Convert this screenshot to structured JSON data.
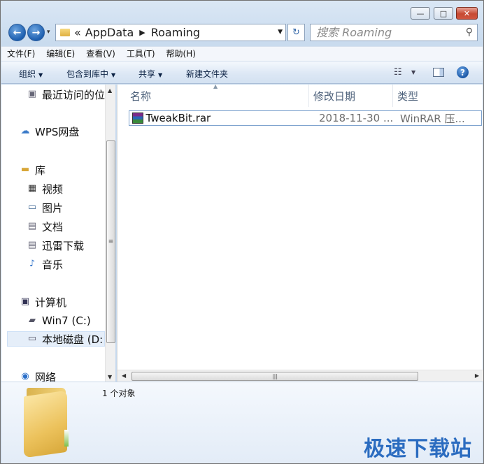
{
  "window": {
    "caption_buttons": {
      "minimize": "—",
      "maximize": "□",
      "close": "✕"
    }
  },
  "navigation": {
    "back_glyph": "←",
    "forward_glyph": "→",
    "history_glyph": "▾",
    "breadcrumb": [
      "AppData",
      "Roaming"
    ],
    "breadcrumb_overflow": "«",
    "refresh_glyph": "↻",
    "search_placeholder": "搜索 Roaming"
  },
  "menubar": {
    "items": [
      "文件(F)",
      "编辑(E)",
      "查看(V)",
      "工具(T)",
      "帮助(H)"
    ]
  },
  "commandbar": {
    "organize": "组织",
    "include_in_library": "包含到库中",
    "share": "共享",
    "new_folder": "新建文件夹",
    "help_glyph": "?"
  },
  "navpane": {
    "items": [
      {
        "label": "最近访问的位",
        "icon": "recent-places-icon"
      },
      {
        "label": "WPS网盘",
        "icon": "cloud-icon"
      },
      {
        "label": "库",
        "icon": "libraries-icon"
      },
      {
        "label": "视频",
        "icon": "video-icon"
      },
      {
        "label": "图片",
        "icon": "pictures-icon"
      },
      {
        "label": "文档",
        "icon": "documents-icon"
      },
      {
        "label": "迅雷下载",
        "icon": "download-icon"
      },
      {
        "label": "音乐",
        "icon": "music-icon"
      },
      {
        "label": "计算机",
        "icon": "computer-icon"
      },
      {
        "label": "Win7 (C:)",
        "icon": "drive-icon"
      },
      {
        "label": "本地磁盘 (D:",
        "icon": "drive-icon",
        "selected": true
      },
      {
        "label": "网络",
        "icon": "network-icon"
      }
    ]
  },
  "filelist": {
    "columns": {
      "name": "名称",
      "date": "修改日期",
      "type": "类型"
    },
    "rows": [
      {
        "name": "TweakBit.rar",
        "date": "2018-11-30 ...",
        "type": "WinRAR 压..."
      }
    ]
  },
  "details": {
    "status": "1 个对象"
  },
  "watermark": "极速下载站"
}
